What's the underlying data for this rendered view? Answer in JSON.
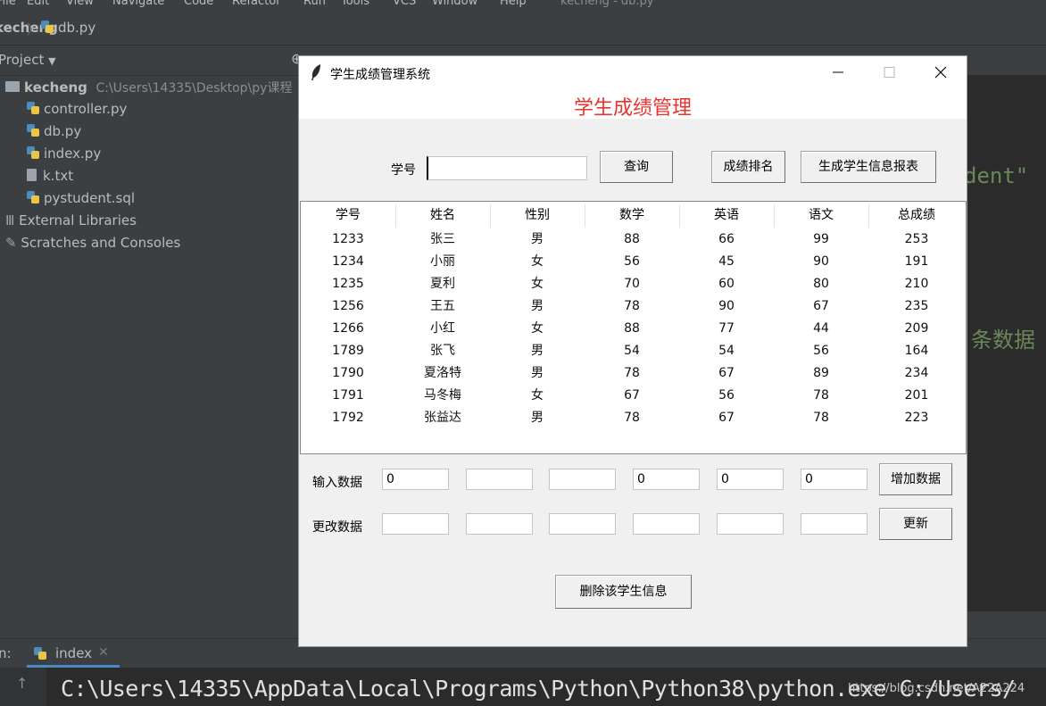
{
  "ide": {
    "menu": [
      "File",
      "Edit",
      "View",
      "Navigate",
      "Code",
      "Refactor",
      "Run",
      "Tools",
      "VCS",
      "Window",
      "Help"
    ],
    "menu_title": "kecheng - db.py",
    "breadcrumb": [
      "kecheng",
      "db.py"
    ],
    "project_label": "Project",
    "root_name": "kecheng",
    "root_path": "C:\\Users\\14335\\Desktop\\py课程",
    "files": [
      "controller.py",
      "db.py",
      "index.py",
      "k.txt",
      "pystudent.sql"
    ],
    "external_libraries": "External Libraries",
    "scratches": "Scratches and Consoles",
    "editor_fragment_1": "dent\"",
    "editor_fragment_2": "条数据",
    "run_label": "n:",
    "run_tab": "index",
    "console_text": "C:\\Users\\14335\\AppData\\Local\\Programs\\Python\\Python38\\python.exe C:/Users/",
    "watermark": "https://blog.csdn.net/A22A224"
  },
  "window": {
    "title": "学生成绩管理系统",
    "banner": "学生成绩管理"
  },
  "search": {
    "label": "学号",
    "value": "",
    "query_button": "查询",
    "rank_button": "成绩排名",
    "report_button": "生成学生信息报表"
  },
  "table": {
    "columns": [
      "学号",
      "姓名",
      "性别",
      "数学",
      "英语",
      "语文",
      "总成绩"
    ],
    "rows": [
      [
        "1233",
        "张三",
        "男",
        "88",
        "66",
        "99",
        "253"
      ],
      [
        "1234",
        "小丽",
        "女",
        "56",
        "45",
        "90",
        "191"
      ],
      [
        "1235",
        "夏利",
        "女",
        "70",
        "60",
        "80",
        "210"
      ],
      [
        "1256",
        "王五",
        "男",
        "78",
        "90",
        "67",
        "235"
      ],
      [
        "1266",
        "小红",
        "女",
        "88",
        "77",
        "44",
        "209"
      ],
      [
        "1789",
        "张飞",
        "男",
        "54",
        "54",
        "56",
        "164"
      ],
      [
        "1790",
        "夏洛特",
        "男",
        "78",
        "67",
        "89",
        "234"
      ],
      [
        "1791",
        "马冬梅",
        "女",
        "67",
        "56",
        "78",
        "201"
      ],
      [
        "1792",
        "张益达",
        "男",
        "78",
        "67",
        "78",
        "223"
      ]
    ]
  },
  "input_row": {
    "label": "输入数据",
    "values": [
      "0",
      "",
      "",
      "0",
      "0",
      "0"
    ],
    "button": "增加数据"
  },
  "update_row": {
    "label": "更改数据",
    "values": [
      "",
      "",
      "",
      "",
      "",
      ""
    ],
    "button": "更新"
  },
  "delete_button": "删除该学生信息"
}
